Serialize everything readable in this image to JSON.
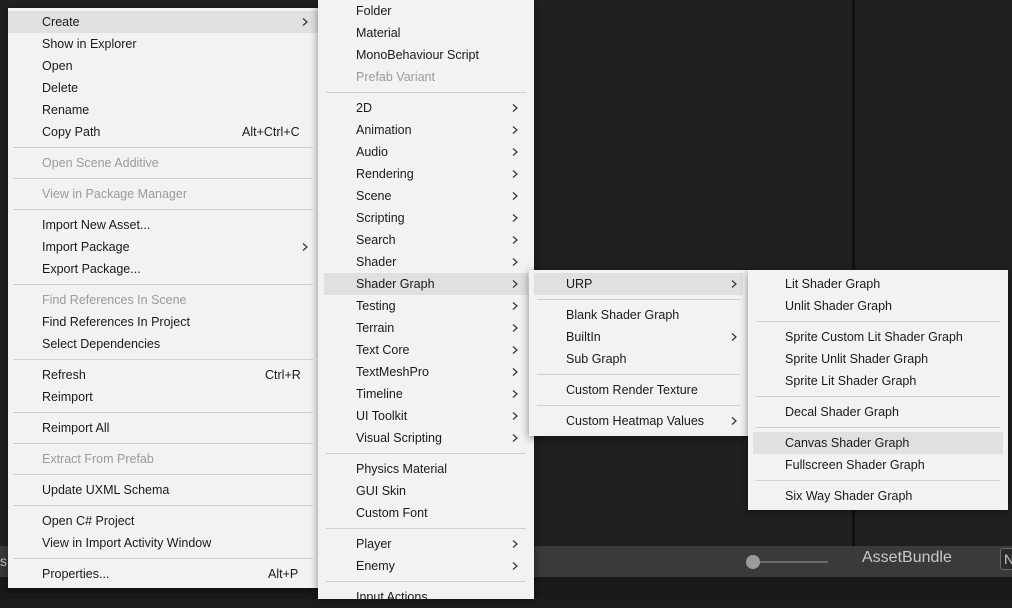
{
  "background": {
    "asset_bundle_label": "AssetBundle",
    "asset_bundle_value": "N",
    "left_fragment": "s"
  },
  "menu1": {
    "items": [
      {
        "label": "Create",
        "submenu": true,
        "highlight": true
      },
      {
        "label": "Show in Explorer"
      },
      {
        "label": "Open"
      },
      {
        "label": "Delete"
      },
      {
        "label": "Rename"
      },
      {
        "label": "Copy Path",
        "shortcut": "Alt+Ctrl+C"
      },
      {
        "label": "Open Scene Additive",
        "disabled": true
      },
      {
        "label": "View in Package Manager",
        "disabled": true
      },
      {
        "label": "Import New Asset..."
      },
      {
        "label": "Import Package",
        "submenu": true
      },
      {
        "label": "Export Package..."
      },
      {
        "label": "Find References In Scene",
        "disabled": true
      },
      {
        "label": "Find References In Project"
      },
      {
        "label": "Select Dependencies"
      },
      {
        "label": "Refresh",
        "shortcut": "Ctrl+R"
      },
      {
        "label": "Reimport"
      },
      {
        "label": "Reimport All"
      },
      {
        "label": "Extract From Prefab",
        "disabled": true
      },
      {
        "label": "Update UXML Schema"
      },
      {
        "label": "Open C# Project"
      },
      {
        "label": "View in Import Activity Window"
      },
      {
        "label": "Properties...",
        "shortcut": "Alt+P"
      }
    ]
  },
  "menu2": {
    "items": [
      {
        "label": "Folder"
      },
      {
        "label": "Material"
      },
      {
        "label": "MonoBehaviour Script"
      },
      {
        "label": "Prefab Variant",
        "disabled": true
      },
      {
        "label": "2D",
        "submenu": true
      },
      {
        "label": "Animation",
        "submenu": true
      },
      {
        "label": "Audio",
        "submenu": true
      },
      {
        "label": "Rendering",
        "submenu": true
      },
      {
        "label": "Scene",
        "submenu": true
      },
      {
        "label": "Scripting",
        "submenu": true
      },
      {
        "label": "Search",
        "submenu": true
      },
      {
        "label": "Shader",
        "submenu": true
      },
      {
        "label": "Shader Graph",
        "submenu": true,
        "highlight": true
      },
      {
        "label": "Testing",
        "submenu": true
      },
      {
        "label": "Terrain",
        "submenu": true
      },
      {
        "label": "Text Core",
        "submenu": true
      },
      {
        "label": "TextMeshPro",
        "submenu": true
      },
      {
        "label": "Timeline",
        "submenu": true
      },
      {
        "label": "UI Toolkit",
        "submenu": true
      },
      {
        "label": "Visual Scripting",
        "submenu": true
      },
      {
        "label": "Physics Material"
      },
      {
        "label": "GUI Skin"
      },
      {
        "label": "Custom Font"
      },
      {
        "label": "Player",
        "submenu": true
      },
      {
        "label": "Enemy",
        "submenu": true
      },
      {
        "label": "Input Actions"
      }
    ]
  },
  "menu3": {
    "items": [
      {
        "label": "URP",
        "submenu": true,
        "highlight": true
      },
      {
        "label": "Blank Shader Graph"
      },
      {
        "label": "BuiltIn",
        "submenu": true
      },
      {
        "label": "Sub Graph"
      },
      {
        "label": "Custom Render Texture"
      },
      {
        "label": "Custom Heatmap Values",
        "submenu": true
      }
    ]
  },
  "menu4": {
    "items": [
      {
        "label": "Lit Shader Graph"
      },
      {
        "label": "Unlit Shader Graph"
      },
      {
        "label": "Sprite Custom Lit Shader Graph"
      },
      {
        "label": "Sprite Unlit Shader Graph"
      },
      {
        "label": "Sprite Lit Shader Graph"
      },
      {
        "label": "Decal Shader Graph"
      },
      {
        "label": "Canvas Shader Graph",
        "highlight": true
      },
      {
        "label": "Fullscreen Shader Graph"
      },
      {
        "label": "Six Way Shader Graph"
      }
    ]
  }
}
